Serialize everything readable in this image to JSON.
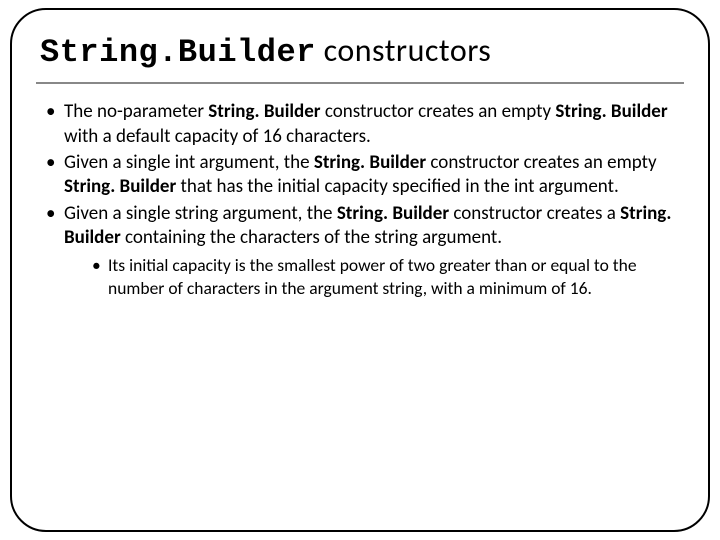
{
  "title": {
    "mono": "String.Builder",
    "rest": " constructors"
  },
  "bullets": [
    {
      "runs": [
        {
          "t": "The no-parameter "
        },
        {
          "t": "String. Builder",
          "b": true
        },
        {
          "t": " constructor creates an empty "
        },
        {
          "t": "String. Builder",
          "b": true
        },
        {
          "t": " with a default capacity of 16 characters."
        }
      ]
    },
    {
      "runs": [
        {
          "t": "Given a single int argument, the "
        },
        {
          "t": "String. Builder",
          "b": true
        },
        {
          "t": " constructor creates an empty "
        },
        {
          "t": "String. Builder",
          "b": true
        },
        {
          "t": " that has the initial capacity specified in the int argument."
        }
      ]
    },
    {
      "runs": [
        {
          "t": "Given a single string argument, the "
        },
        {
          "t": "String. Builder",
          "b": true
        },
        {
          "t": " constructor creates a "
        },
        {
          "t": "String. Builder",
          "b": true
        },
        {
          "t": " containing the characters of the string argument."
        }
      ],
      "sub": [
        {
          "runs": [
            {
              "t": "Its initial capacity is the smallest power of two greater than or equal to the number of characters in the argument string, with a minimum of 16."
            }
          ]
        }
      ]
    }
  ]
}
